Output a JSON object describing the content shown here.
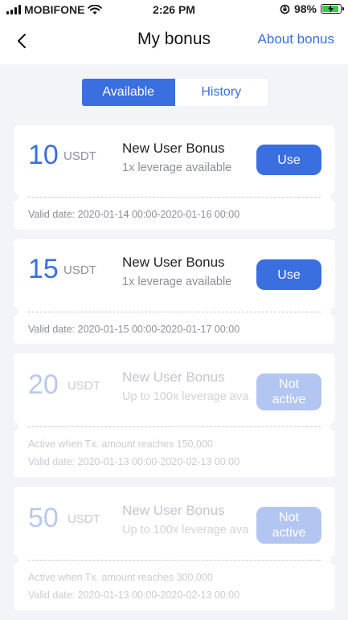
{
  "status_bar": {
    "carrier": "MOBIFONE",
    "time": "2:26 PM",
    "battery": "98%",
    "battery_level": 0.98
  },
  "nav": {
    "title": "My bonus",
    "right_link": "About bonus"
  },
  "tabs": [
    {
      "label": "Available",
      "active": true
    },
    {
      "label": "History",
      "active": false
    }
  ],
  "cards": [
    {
      "amount": "10",
      "unit": "USDT",
      "title": "New User Bonus",
      "subtitle": "1x leverage available",
      "action": "Use",
      "active_condition": "",
      "valid_date": "Valid date: 2020-01-14 00:00-2020-01-16 00:00",
      "enabled": true
    },
    {
      "amount": "15",
      "unit": "USDT",
      "title": "New User Bonus",
      "subtitle": "1x leverage available",
      "action": "Use",
      "active_condition": "",
      "valid_date": "Valid date: 2020-01-15 00:00-2020-01-17 00:00",
      "enabled": true
    },
    {
      "amount": "20",
      "unit": "USDT",
      "title": "New User Bonus",
      "subtitle": "Up to 100x leverage ava",
      "action": "Not active",
      "active_condition": "Active when Tx. amount reaches 150,000",
      "valid_date": "Valid date: 2020-01-13 00:00-2020-02-13 00:00",
      "enabled": false
    },
    {
      "amount": "50",
      "unit": "USDT",
      "title": "New User Bonus",
      "subtitle": "Up to 100x leverage ava",
      "action": "Not active",
      "active_condition": "Active when Tx. amount reaches 300,000",
      "valid_date": "Valid date: 2020-01-13 00:00-2020-02-13 00:00",
      "enabled": false
    }
  ],
  "colors": {
    "accent": "#3a6fe0",
    "background": "#f2f4f7",
    "disabled_button": "#b3c6f1"
  }
}
